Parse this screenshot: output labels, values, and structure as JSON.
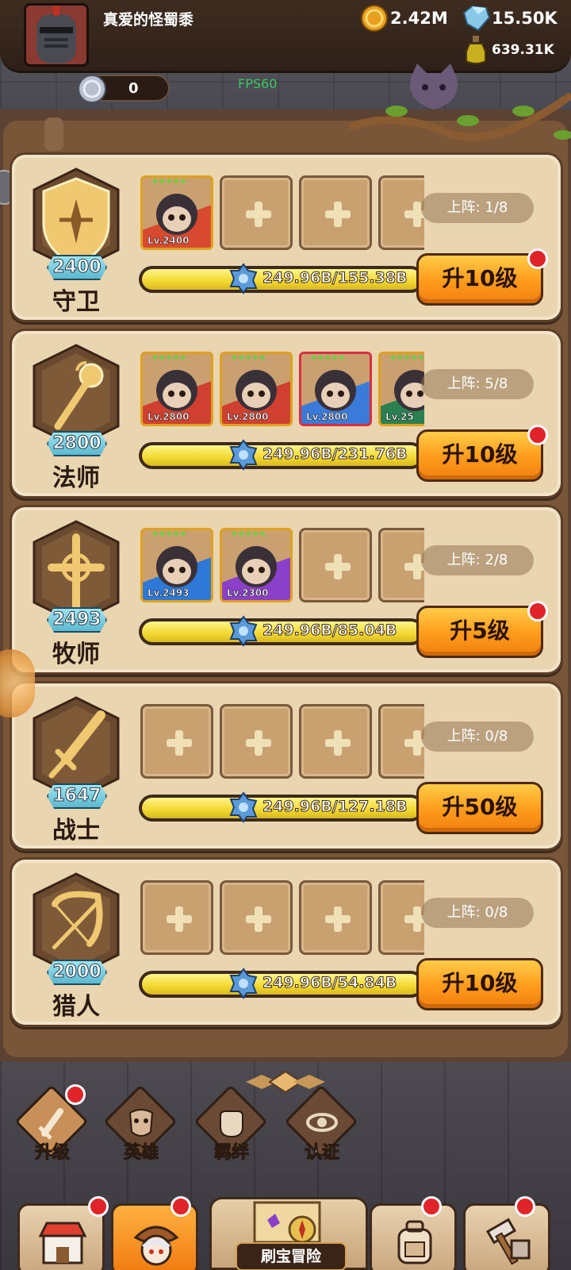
{
  "header": {
    "player_name": "真爱的怪蜀黍",
    "gold": "2.42M",
    "gems": "15.50K",
    "potion": "639.31K",
    "coins": "0",
    "fps": "FPS60"
  },
  "classes": [
    {
      "level": "2400",
      "name": "守卫",
      "deploy": "上阵: 1/8",
      "progress_text": "249.96B/155.38B",
      "upgrade": "升10级",
      "has_alert": true,
      "heroes": [
        {
          "lv": "Lv.2400",
          "frame": "#e0a020",
          "bg": "#d84a30",
          "stars": "✦✦✦✦✦"
        }
      ]
    },
    {
      "level": "2800",
      "name": "法师",
      "deploy": "上阵: 5/8",
      "progress_text": "249.96B/231.76B",
      "upgrade": "升10级",
      "has_alert": true,
      "heroes": [
        {
          "lv": "Lv.2800",
          "frame": "#e0a020",
          "bg": "#d04030",
          "stars": "✦✦✦✦✦"
        },
        {
          "lv": "Lv.2800",
          "frame": "#e0a020",
          "bg": "#d04030",
          "stars": "✦✦✦✦✦"
        },
        {
          "lv": "Lv.2800",
          "frame": "#d83040",
          "bg": "#3a7ad8",
          "stars": "✦✦✦✦✦"
        },
        {
          "lv": "Lv.25",
          "frame": "#e0a020",
          "bg": "#2a8050",
          "stars": "✦✦✦✦✦"
        }
      ]
    },
    {
      "level": "2493",
      "name": "牧师",
      "deploy": "上阵: 2/8",
      "progress_text": "249.96B/85.04B",
      "upgrade": "升5级",
      "has_alert": true,
      "heroes": [
        {
          "lv": "Lv.2493",
          "frame": "#e0a020",
          "bg": "#2e78d8",
          "stars": "✦✦✦✦✦"
        },
        {
          "lv": "Lv.2300",
          "frame": "#e0a020",
          "bg": "#8a40c8",
          "stars": "✦✦✦✦✦"
        }
      ]
    },
    {
      "level": "1647",
      "name": "战士",
      "deploy": "上阵: 0/8",
      "progress_text": "249.96B/127.18B",
      "upgrade": "升50级",
      "has_alert": false,
      "heroes": []
    },
    {
      "level": "2000",
      "name": "猎人",
      "deploy": "上阵: 0/8",
      "progress_text": "249.96B/54.84B",
      "upgrade": "升10级",
      "has_alert": false,
      "heroes": []
    }
  ],
  "tabs": [
    {
      "label": "升级",
      "icon": "sword-upgrade-icon",
      "active": true,
      "alert": true
    },
    {
      "label": "英雄",
      "icon": "hero-mask-icon",
      "active": false,
      "alert": false
    },
    {
      "label": "羁绊",
      "icon": "fist-bond-icon",
      "active": false,
      "alert": false
    },
    {
      "label": "认证",
      "icon": "eye-certify-icon",
      "active": false,
      "alert": false
    }
  ],
  "bottom_nav": {
    "adventure_label": "刷宝冒险"
  },
  "colors": {
    "accent_orange": "#ff9a1a",
    "progress_yellow": "#f2d830",
    "alert_red": "#e0242a",
    "badge_cyan": "#5cb8d0"
  }
}
